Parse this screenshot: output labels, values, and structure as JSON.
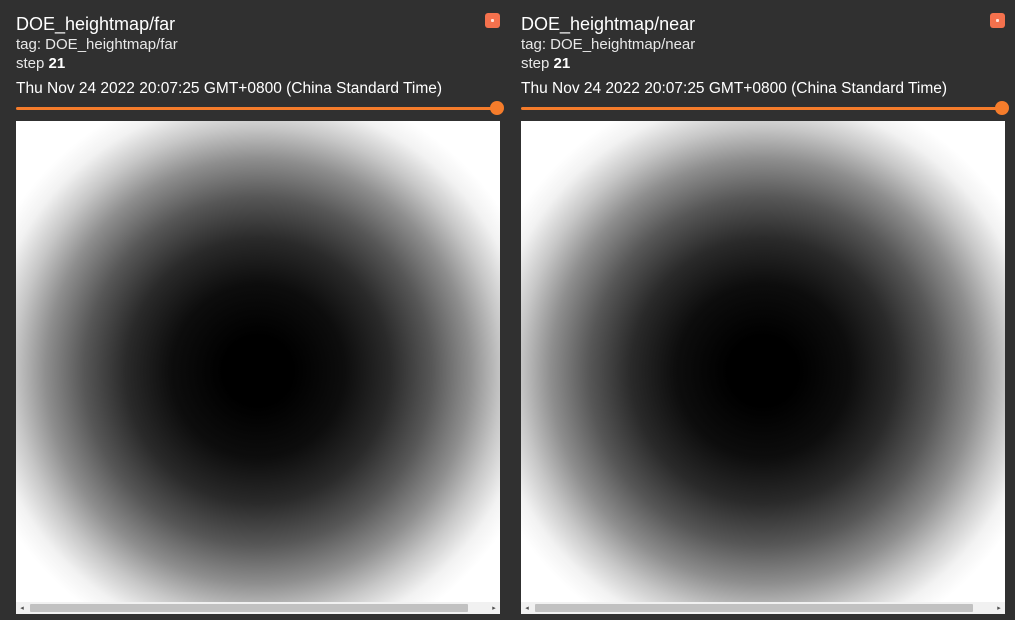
{
  "cards": [
    {
      "title": "DOE_heightmap/far",
      "tag_text": "tag: DOE_heightmap/far",
      "step_label": "step",
      "step_value": "21",
      "timestamp": "Thu Nov 24 2022 20:07:25 GMT+0800 (China Standard Time)",
      "slider_position": 1.0
    },
    {
      "title": "DOE_heightmap/near",
      "tag_text": "tag: DOE_heightmap/near",
      "step_label": "step",
      "step_value": "21",
      "timestamp": "Thu Nov 24 2022 20:07:25 GMT+0800 (China Standard Time)",
      "slider_position": 1.0
    }
  ],
  "colors": {
    "background": "#303030",
    "accent_slider": "#f57c2b",
    "expand_button": "#f4714d"
  },
  "icons": {
    "expand": "expand-icon",
    "scroll_left": "scroll-left-arrow-icon",
    "scroll_right": "scroll-right-arrow-icon",
    "arrow_left_glyph": "◂",
    "arrow_right_glyph": "▸"
  }
}
